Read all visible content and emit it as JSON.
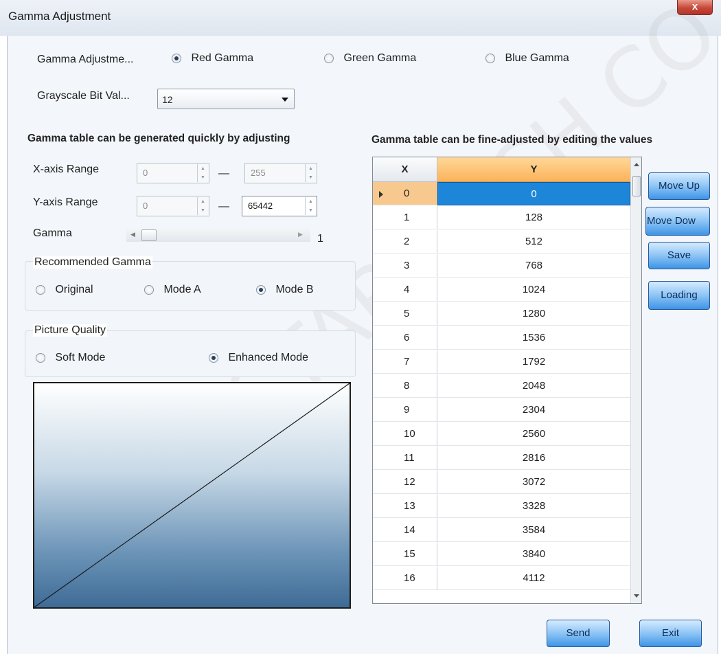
{
  "window": {
    "title": "Gamma Adjustment",
    "close_glyph": "x"
  },
  "gamma_adjustment": {
    "label": "Gamma Adjustme...",
    "options": [
      {
        "label": "Red Gamma",
        "selected": true
      },
      {
        "label": "Green Gamma",
        "selected": false
      },
      {
        "label": "Blue Gamma",
        "selected": false
      }
    ]
  },
  "grayscale": {
    "label": "Grayscale Bit Val...",
    "value": "12"
  },
  "left_panel": {
    "heading": "Gamma table can be generated quickly by adjusting",
    "x_axis": {
      "label": "X-axis Range",
      "min": "0",
      "max": "255",
      "separator": "—"
    },
    "y_axis": {
      "label": "Y-axis Range",
      "min": "0",
      "max": "65442",
      "separator": "—"
    },
    "gamma": {
      "label": "Gamma",
      "value": "1"
    }
  },
  "recommended_gamma": {
    "title": "Recommended Gamma",
    "options": [
      {
        "label": "Original",
        "selected": false
      },
      {
        "label": "Mode A",
        "selected": false
      },
      {
        "label": "Mode B",
        "selected": true
      }
    ]
  },
  "picture_quality": {
    "title": "Picture Quality",
    "options": [
      {
        "label": "Soft Mode",
        "selected": false
      },
      {
        "label": "Enhanced Mode",
        "selected": true
      }
    ]
  },
  "right_panel": {
    "heading": "Gamma table can be fine-adjusted by editing the values"
  },
  "table": {
    "columns": [
      "X",
      "Y"
    ],
    "selected_row": 0,
    "rows": [
      [
        "0",
        "0"
      ],
      [
        "1",
        "128"
      ],
      [
        "2",
        "512"
      ],
      [
        "3",
        "768"
      ],
      [
        "4",
        "1024"
      ],
      [
        "5",
        "1280"
      ],
      [
        "6",
        "1536"
      ],
      [
        "7",
        "1792"
      ],
      [
        "8",
        "2048"
      ],
      [
        "9",
        "2304"
      ],
      [
        "10",
        "2560"
      ],
      [
        "11",
        "2816"
      ],
      [
        "12",
        "3072"
      ],
      [
        "13",
        "3328"
      ],
      [
        "14",
        "3584"
      ],
      [
        "15",
        "3840"
      ],
      [
        "16",
        "4112"
      ]
    ]
  },
  "side_buttons": {
    "move_up": "Move Up",
    "move_down": "Move Dow",
    "save": "Save",
    "loading": "Loading"
  },
  "footer": {
    "send": "Send",
    "exit": "Exit"
  },
  "watermark": "NOVASTAR TECH CO.,"
}
